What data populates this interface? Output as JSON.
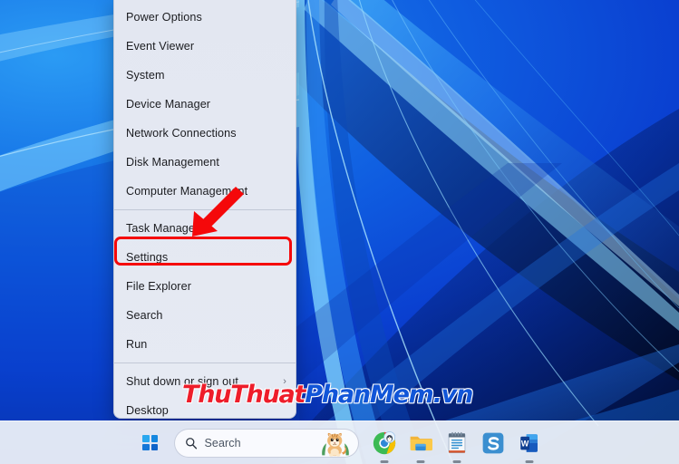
{
  "desktop": {
    "wallpaper_name": "windows-11-bloom-blue",
    "background_color": "#0b3fd6"
  },
  "context_menu": {
    "name": "win-x-power-user-menu",
    "items": [
      {
        "label": "Power Options",
        "has_submenu": false,
        "separator_after": false
      },
      {
        "label": "Event Viewer",
        "has_submenu": false,
        "separator_after": false
      },
      {
        "label": "System",
        "has_submenu": false,
        "separator_after": false
      },
      {
        "label": "Device Manager",
        "has_submenu": false,
        "separator_after": false
      },
      {
        "label": "Network Connections",
        "has_submenu": false,
        "separator_after": false
      },
      {
        "label": "Disk Management",
        "has_submenu": false,
        "separator_after": false
      },
      {
        "label": "Computer Management",
        "has_submenu": false,
        "separator_after": true
      },
      {
        "label": "Task Manager",
        "has_submenu": false,
        "separator_after": false
      },
      {
        "label": "Settings",
        "has_submenu": false,
        "separator_after": false,
        "highlighted": true
      },
      {
        "label": "File Explorer",
        "has_submenu": false,
        "separator_after": false
      },
      {
        "label": "Search",
        "has_submenu": false,
        "separator_after": false
      },
      {
        "label": "Run",
        "has_submenu": false,
        "separator_after": true
      },
      {
        "label": "Shut down or sign out",
        "has_submenu": true,
        "submenu_glyph": "›",
        "separator_after": false
      },
      {
        "label": "Desktop",
        "has_submenu": false,
        "separator_after": false
      }
    ]
  },
  "annotations": {
    "highlight_color": "#f5080a",
    "highlight_target": "Settings",
    "arrow_color": "#f5080a",
    "arrow_points_to": "Settings"
  },
  "taskbar": {
    "start_button_label": "Start",
    "search": {
      "placeholder": "Search",
      "icon": "search-icon",
      "mascot": "cat-illustration"
    },
    "apps": [
      {
        "name": "chrome-browser",
        "label": "Google Chrome",
        "running": true
      },
      {
        "name": "file-explorer",
        "label": "File Explorer",
        "running": true
      },
      {
        "name": "notepad",
        "label": "Notepad",
        "running": true
      },
      {
        "name": "snagit",
        "label": "Snagit",
        "running": false
      },
      {
        "name": "microsoft-word",
        "label": "Microsoft Word",
        "running": true
      }
    ]
  },
  "watermark": {
    "part_red": "ThuThuat",
    "part_blue": "PhanMem.vn",
    "color_red": "#ee1d2a",
    "color_blue": "#1155d8"
  }
}
